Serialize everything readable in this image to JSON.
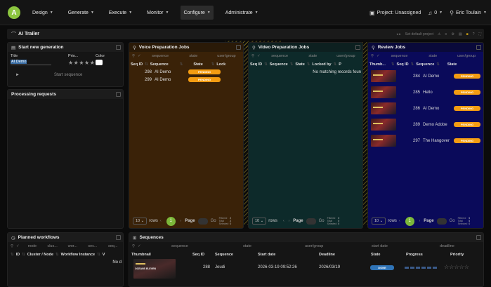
{
  "topbar": {
    "logo_letter": "A",
    "menu": [
      {
        "label": "Design"
      },
      {
        "label": "Generate"
      },
      {
        "label": "Execute"
      },
      {
        "label": "Monitor"
      },
      {
        "label": "Configure"
      },
      {
        "label": "Administrate"
      }
    ],
    "project": "Project: Unassigned",
    "notifications": "0",
    "user": "Eric Toulain"
  },
  "titlebar": {
    "title": "AI Trailer",
    "default_project": "Set default project"
  },
  "start_panel": {
    "title": "Start new generation",
    "col_title": "Title",
    "col_priority": "Prio...",
    "col_color": "Color",
    "title_value": "AI Demo",
    "stars": "★★★★★",
    "start_label": "Start sequence"
  },
  "processing_panel": {
    "title": "Processing requests"
  },
  "voice_panel": {
    "title": "Voice Preparation Jobs",
    "filters": [
      "sequence",
      "state",
      "user/group"
    ],
    "headers": [
      "Seq ID",
      "Sequence",
      "State",
      "Lock"
    ],
    "rows": [
      {
        "id": "298",
        "sequence": "AI Demo",
        "state": "PENDING"
      },
      {
        "id": "299",
        "sequence": "AI Demo",
        "state": "PENDING"
      }
    ],
    "pager": {
      "rows": "10",
      "rows_label": "rows",
      "page": "1",
      "page_label": "Page",
      "go": "Go",
      "stats_labels": "Filtered\nTotal\nSelected",
      "stats_values": "2\n2\n0"
    }
  },
  "video_panel": {
    "title": "Video Preparation Jobs",
    "filters": [
      "sequence",
      "state",
      "user/group"
    ],
    "headers": [
      "Seq ID",
      "Sequence",
      "State",
      "Locked by",
      "P"
    ],
    "empty": "No matching records foun",
    "pager": {
      "rows": "10",
      "rows_label": "rows",
      "page_label": "Page",
      "go": "Go",
      "stats_labels": "Filtered\nTotal\nSelected",
      "stats_values": "0\n0\n0"
    }
  },
  "review_panel": {
    "title": "Review Jobs",
    "filters": [
      "sequence",
      "state",
      "user/group"
    ],
    "headers": [
      "Thumb...",
      "Seq ID",
      "Sequence",
      "State"
    ],
    "rows": [
      {
        "id": "284",
        "sequence": "AI Demo",
        "state": "PENDING"
      },
      {
        "id": "285",
        "sequence": "Hello",
        "state": "PENDING"
      },
      {
        "id": "286",
        "sequence": "AI Demo",
        "state": "PENDING"
      },
      {
        "id": "289",
        "sequence": "Demo Adobe",
        "state": "PENDING"
      },
      {
        "id": "297",
        "sequence": "The Hangover",
        "state": "PENDING"
      }
    ],
    "pager": {
      "rows": "10",
      "rows_label": "rows",
      "page": "1",
      "page_label": "Page",
      "go": "Go",
      "stats_labels": "Filtered\nTotal\nSelected",
      "stats_values": "5\n5\n0"
    }
  },
  "workflows_panel": {
    "title": "Planned workflows",
    "filters": [
      "node",
      "clus...",
      "wor...",
      "sec...",
      "seq..."
    ],
    "headers": [
      "ID",
      "Cluster / Node",
      "Workflow Instance",
      "V"
    ],
    "empty": "No d"
  },
  "sequences_panel": {
    "title": "Sequences",
    "filters": [
      "sequence",
      "state",
      "user/group",
      "start date",
      "deadline"
    ],
    "headers": [
      "Thumbnail",
      "Seq ID",
      "Sequence",
      "Start date",
      "Deadline",
      "State",
      "Progress",
      "Priority"
    ],
    "rows": [
      {
        "thumb_text": "OCEANS ELEVEN",
        "id": "288",
        "sequence": "Jeudi",
        "start": "2026-03-19 09:52:26",
        "deadline": "2026/03/19",
        "state": "DONE",
        "priority": "☆☆☆☆☆"
      }
    ]
  },
  "colors": {
    "accent_green": "#8cc63f",
    "pending": "#f39c12",
    "done": "#2f74b8",
    "voice_bg": "#3a2208",
    "video_bg": "#0d2a2a",
    "review_bg": "#0a0a5a"
  }
}
